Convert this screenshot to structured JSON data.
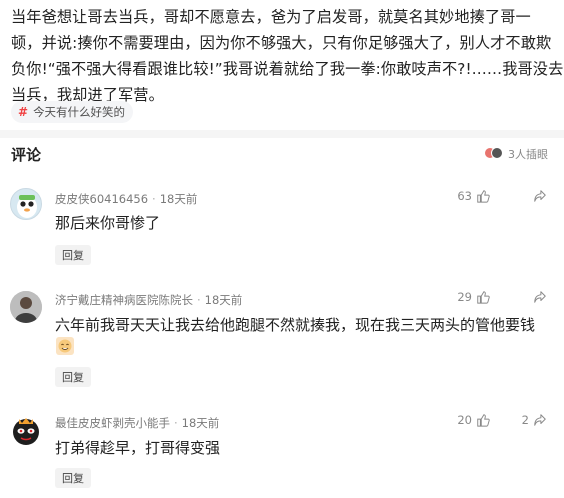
{
  "post": {
    "lines": [
      "当年爸想让哥去当兵，哥却不愿意去，爸为了启发哥，就莫名其妙地揍了哥一",
      "顿，并说:揍你不需要理由，因为你不够强大，只有你足够强大了，别人才不敢欺",
      "负你!“强不强大得看跟谁比较!”我哥说着就给了我一拳:你敢吱声不?!……我哥没去",
      "当兵，我却进了军营。"
    ],
    "topic": "今天有什么好笑的"
  },
  "comments_header": {
    "title": "评论",
    "discussing": "3人插眼"
  },
  "comments": [
    {
      "user": "皮皮侠60416456",
      "time": "18天前",
      "text": "那后来你哥惨了",
      "likes": "63",
      "shares": "",
      "reply": "回复"
    },
    {
      "user": "济宁戴庄精神病医院陈院长",
      "time": "18天前",
      "text": "六年前我哥天天让我去给他跑腿不然就揍我，现在我三天两头的管他要钱",
      "likes": "29",
      "shares": "",
      "reply": "回复"
    },
    {
      "user": "最佳皮皮虾剥壳小能手",
      "time": "18天前",
      "text": "打弟得趁早，打哥得变强",
      "likes": "20",
      "shares": "2",
      "reply": "回复"
    }
  ],
  "icons": {
    "like": "thumb-up-icon",
    "share": "share-icon",
    "topic": "hashtag-icon"
  },
  "colors": {
    "accent": "#f04142",
    "meta": "#7a7a7a"
  }
}
